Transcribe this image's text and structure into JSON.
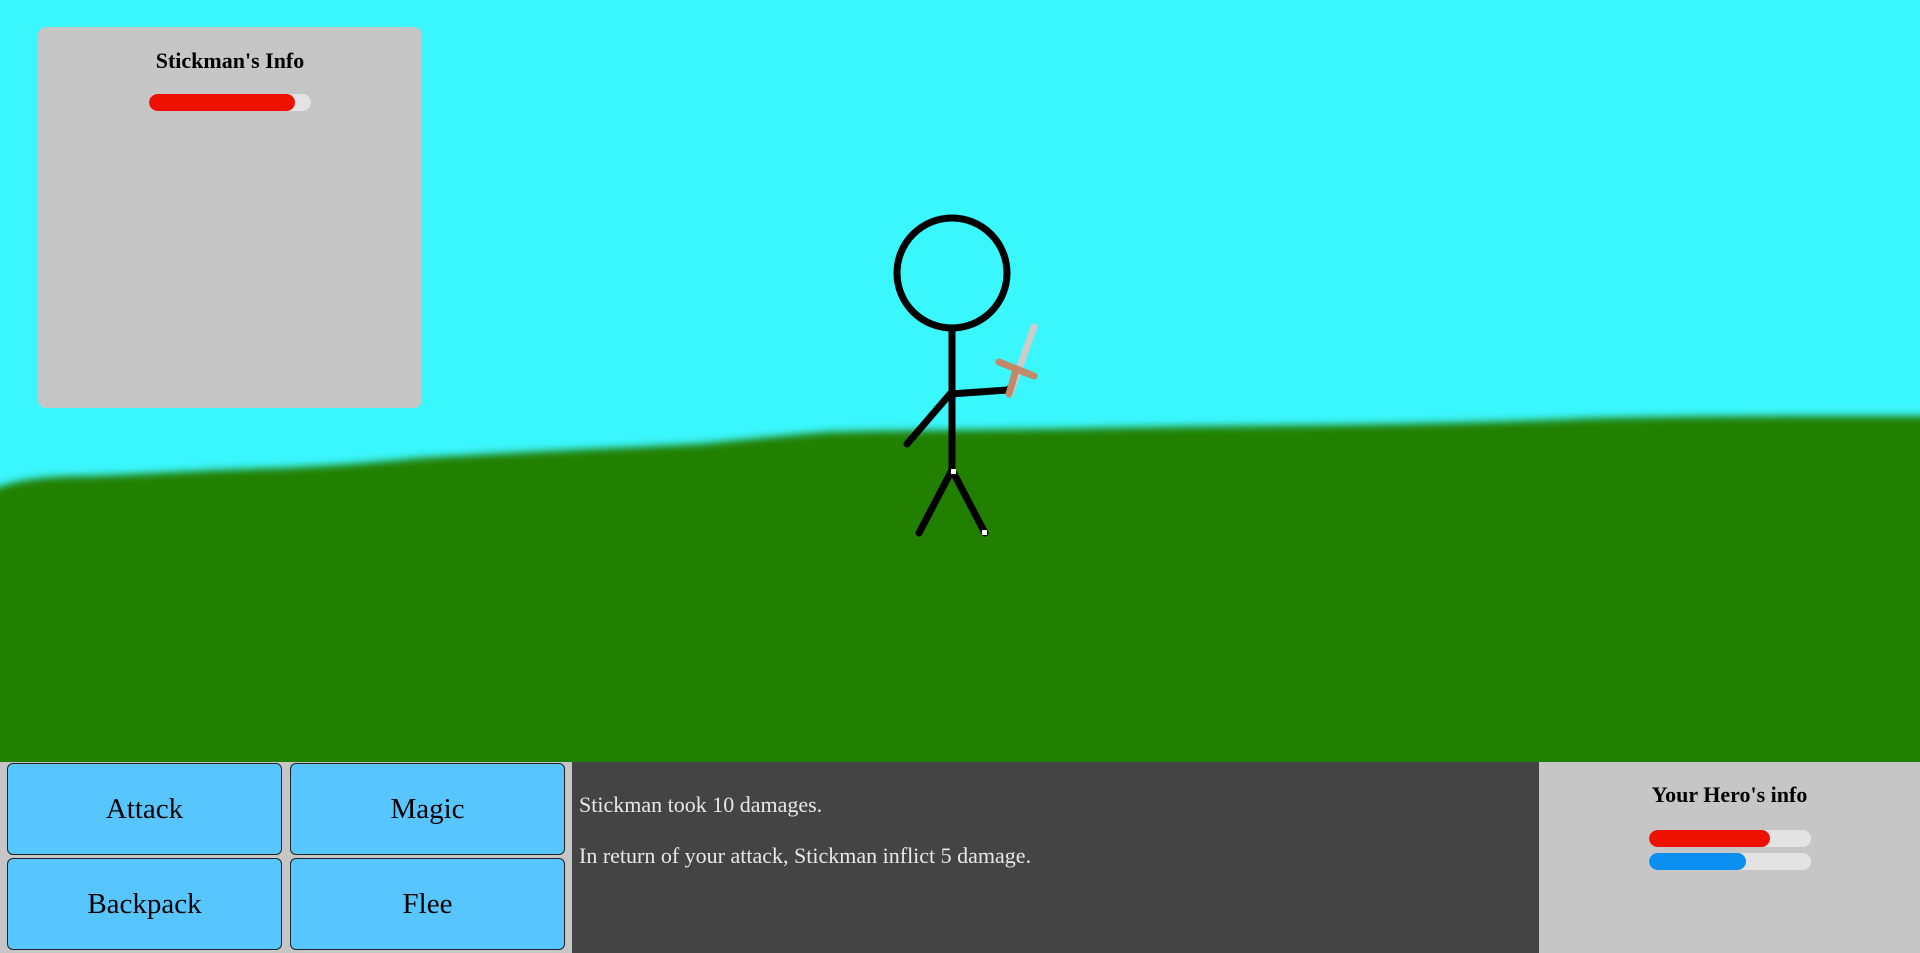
{
  "enemy_panel": {
    "title": "Stickman's Info",
    "hp_fraction": 0.9,
    "hp_color": "#ee1100"
  },
  "hero_panel": {
    "title": "Your Hero's info",
    "hp_fraction": 0.75,
    "mp_fraction": 0.6,
    "hp_color": "#ee1100",
    "mp_color": "#0a8ff0"
  },
  "actions": {
    "attack": "Attack",
    "magic": "Magic",
    "backpack": "Backpack",
    "flee": "Flee"
  },
  "log": {
    "lines": [
      "Stickman took 10 damages.",
      "In return of your attack, Stickman inflict 5 damage."
    ]
  },
  "colors": {
    "sky": "#3af6fd",
    "grass": "#228000",
    "button": "#57c6fe",
    "panel": "#c6c6c6",
    "log_bg": "#444444"
  }
}
